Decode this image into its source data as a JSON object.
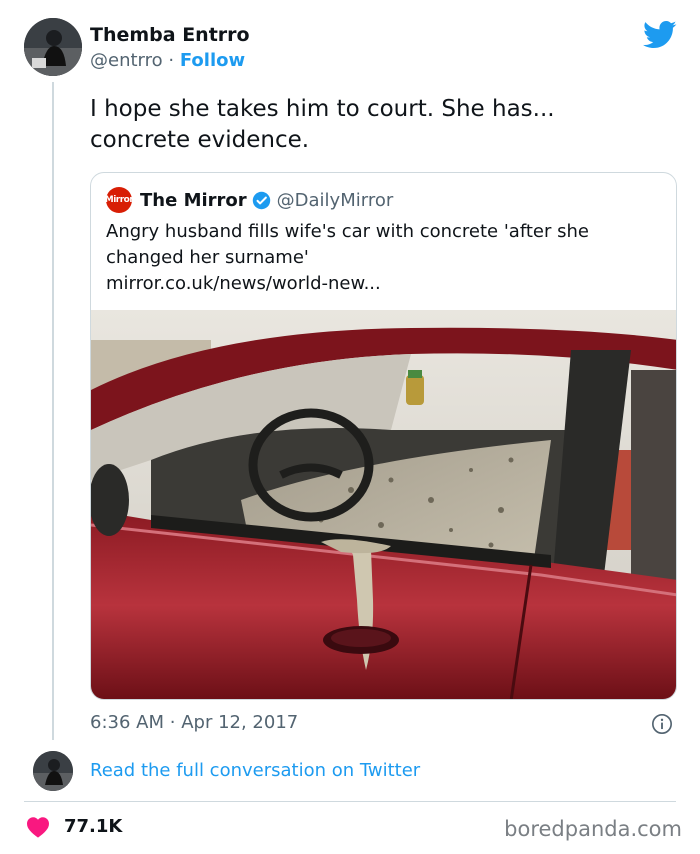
{
  "author": {
    "name": "Themba Entrro",
    "handle": "@entrro",
    "separator": "·",
    "follow_label": "Follow"
  },
  "tweet": {
    "text_line1": "I hope she takes him to court. She has...",
    "text_line2": "concrete evidence."
  },
  "quote": {
    "logo_text": "Mirror",
    "name": "The Mirror",
    "handle": "@DailyMirror",
    "text_line1": "Angry husband fills wife's car with concrete 'after she",
    "text_line2": "changed her surname'",
    "link": "mirror.co.uk/news/world-new..."
  },
  "meta": {
    "time": "6:36 AM",
    "separator": "·",
    "date": "Apr 12, 2017"
  },
  "read_conversation_label": "Read the full conversation on Twitter",
  "likes": "77.1K",
  "watermark": "boredpanda.com",
  "icons": {
    "brand": "twitter-bird-icon",
    "verified": "verified-badge-icon",
    "info": "info-icon",
    "like": "heart-icon"
  },
  "colors": {
    "twitter_blue": "#1d9bf0",
    "like_red": "#f91880",
    "mirror_red": "#d81e05"
  }
}
